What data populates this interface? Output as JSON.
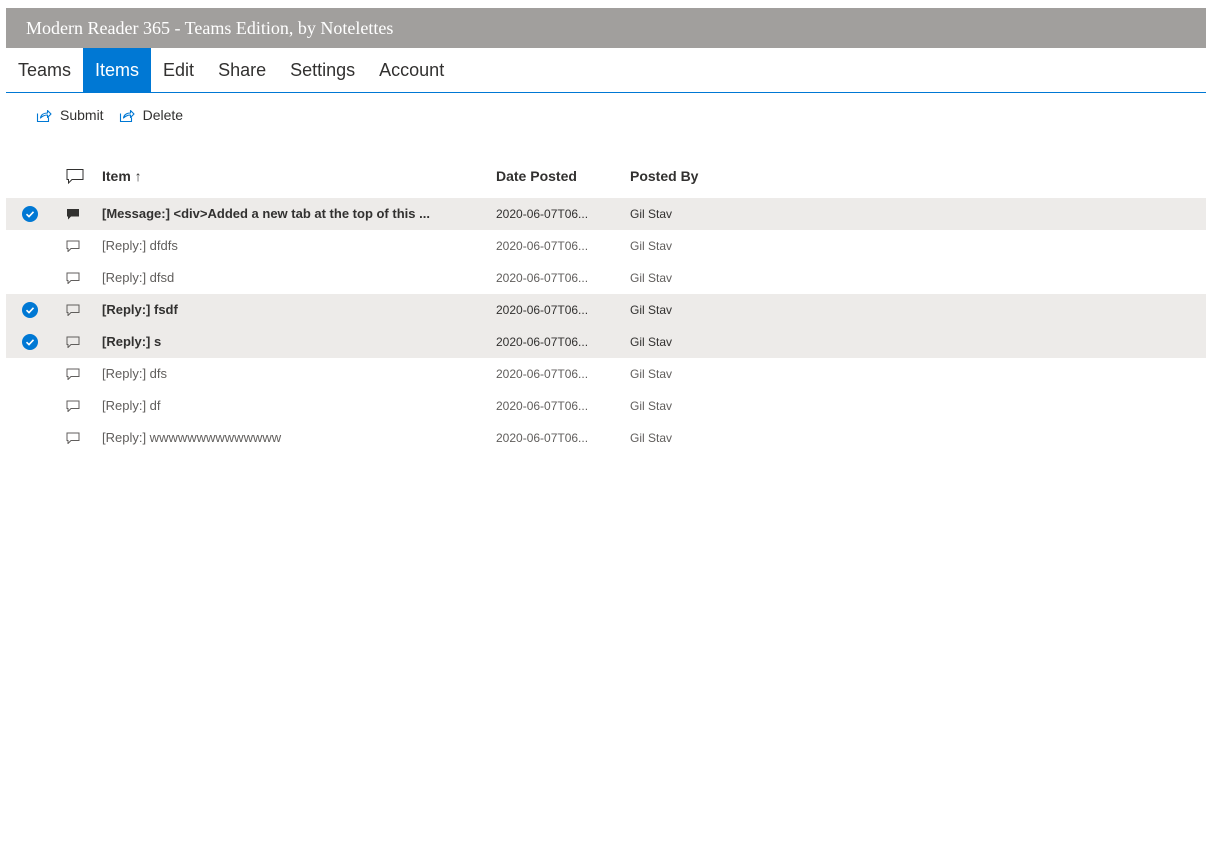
{
  "app": {
    "title": "Modern Reader 365 - Teams Edition, by Notelettes"
  },
  "tabs": [
    {
      "label": "Teams",
      "active": false
    },
    {
      "label": "Items",
      "active": true
    },
    {
      "label": "Edit",
      "active": false
    },
    {
      "label": "Share",
      "active": false
    },
    {
      "label": "Settings",
      "active": false
    },
    {
      "label": "Account",
      "active": false
    }
  ],
  "commands": {
    "submit": "Submit",
    "delete": "Delete",
    "icon": "share-icon"
  },
  "columns": {
    "item": "Item ↑",
    "date": "Date Posted",
    "by": "Posted By"
  },
  "rows": [
    {
      "item": "[Message:] <div>Added a new tab at the top of this ...",
      "date": "2020-06-07T06...",
      "by": "Gil Stav",
      "selected": true,
      "type": "message"
    },
    {
      "item": "[Reply:] dfdfs",
      "date": "2020-06-07T06...",
      "by": "Gil Stav",
      "selected": false,
      "type": "reply"
    },
    {
      "item": "[Reply:] dfsd",
      "date": "2020-06-07T06...",
      "by": "Gil Stav",
      "selected": false,
      "type": "reply"
    },
    {
      "item": "[Reply:] fsdf",
      "date": "2020-06-07T06...",
      "by": "Gil Stav",
      "selected": true,
      "type": "reply"
    },
    {
      "item": "[Reply:] s",
      "date": "2020-06-07T06...",
      "by": "Gil Stav",
      "selected": true,
      "type": "reply"
    },
    {
      "item": "[Reply:] dfs",
      "date": "2020-06-07T06...",
      "by": "Gil Stav",
      "selected": false,
      "type": "reply"
    },
    {
      "item": "[Reply:] df",
      "date": "2020-06-07T06...",
      "by": "Gil Stav",
      "selected": false,
      "type": "reply"
    },
    {
      "item": "[Reply:] wwwwwwwwwwwwww",
      "date": "2020-06-07T06...",
      "by": "Gil Stav",
      "selected": false,
      "type": "reply"
    }
  ],
  "colors": {
    "accent": "#0078d4",
    "titlebar": "#a19f9d",
    "selected_row": "#edebe9"
  }
}
